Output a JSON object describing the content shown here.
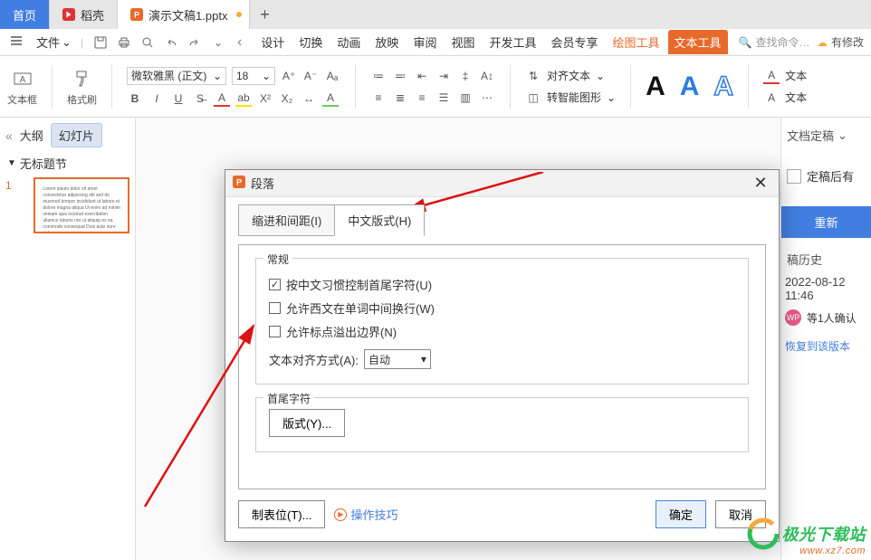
{
  "tabs": {
    "home": "首页",
    "dao": "稻壳",
    "doc": "演示文稿1.pptx",
    "add": "+"
  },
  "menubar": {
    "file": "文件",
    "left_arrow": "‹",
    "menus": [
      "设计",
      "切换",
      "动画",
      "放映",
      "审阅",
      "视图",
      "开发工具",
      "会员专享"
    ],
    "draw": "绘图工具",
    "text": "文本工具",
    "search_ph": "查找命令…",
    "right": "有修改"
  },
  "ribbon": {
    "textbox": "文本框",
    "format": "格式刷",
    "font": "微软雅黑 (正文)",
    "size": "18",
    "align": "对齐文本",
    "convert": "转智能图形",
    "edit": "文本"
  },
  "sidebar": {
    "collapse": "«",
    "outline": "大纲",
    "slide": "幻灯片",
    "section": "无标题节",
    "idx": "1"
  },
  "rightpanel": {
    "head": "文档定稿",
    "block": "定稿后有",
    "btn": "重新",
    "hist": "稿历史",
    "date": "2022-08-12 11:46",
    "user": "等1人确认",
    "link": "恢复到该版本"
  },
  "dialog": {
    "title": "段落",
    "tab1": "缩进和间距(I)",
    "tab2": "中文版式(H)",
    "fs1": "常规",
    "c1": "按中文习惯控制首尾字符(U)",
    "c2": "允许西文在单词中间换行(W)",
    "c3": "允许标点溢出边界(N)",
    "align_label": "文本对齐方式(A):",
    "align_val": "自动",
    "fs2": "首尾字符",
    "fmt_btn": "版式(Y)...",
    "tab_btn": "制表位(T)...",
    "tips": "操作技巧",
    "ok": "确定",
    "cancel": "取消"
  },
  "watermark": {
    "top": "极光下载站",
    "bot": "www.xz7.com"
  }
}
